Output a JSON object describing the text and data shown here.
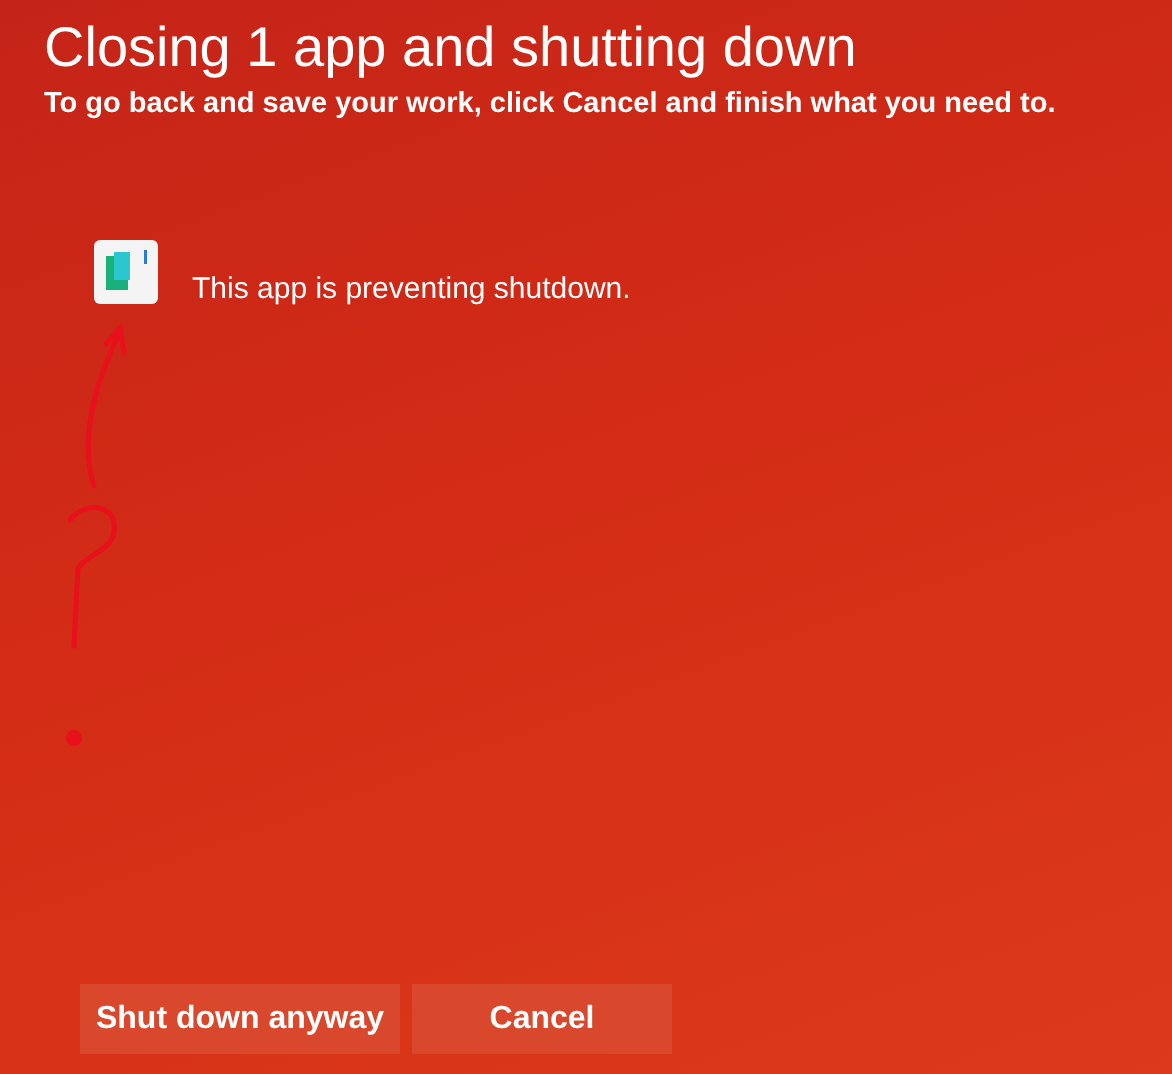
{
  "title": "Closing 1 app and shutting down",
  "message": "To go back and save your work, click Cancel and finish what you need to.",
  "apps": [
    {
      "label": "This app is preventing shutdown."
    }
  ],
  "buttons": [
    "Shut down anyway",
    "Cancel"
  ]
}
